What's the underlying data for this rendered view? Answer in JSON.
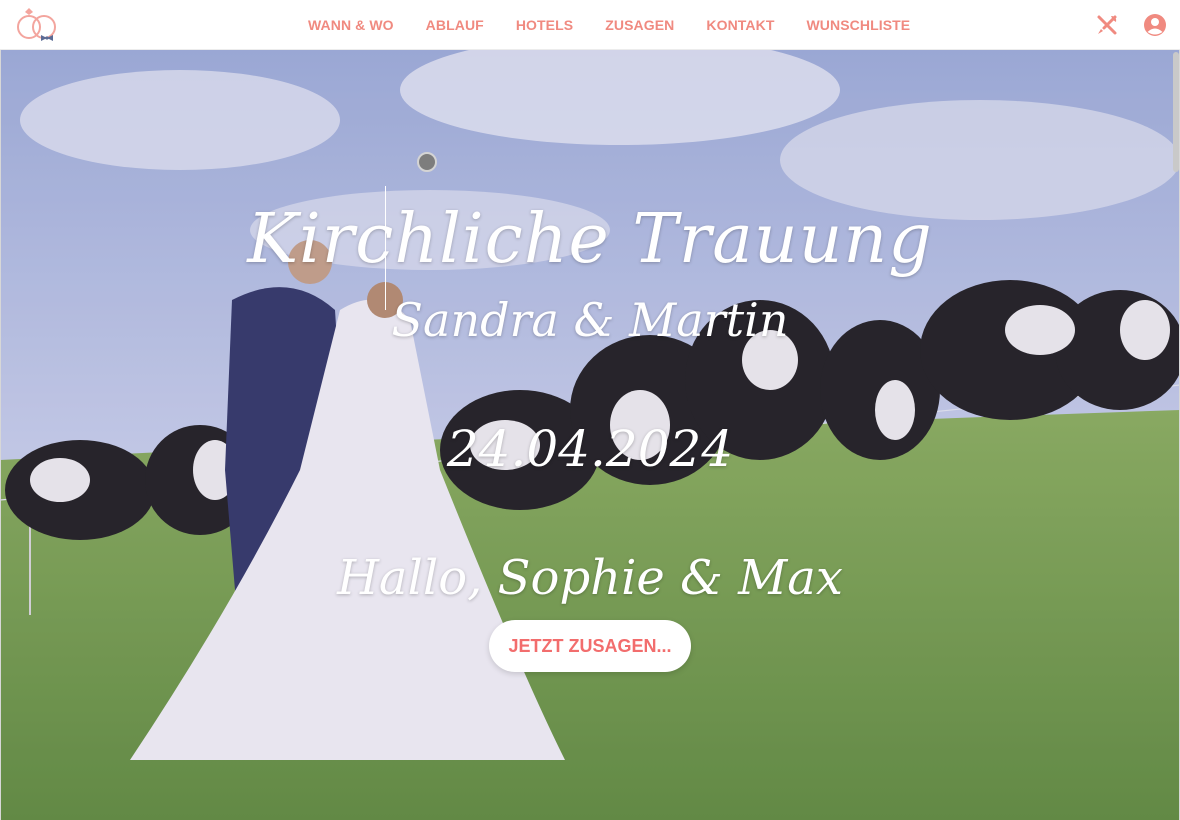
{
  "nav": {
    "links": [
      "WANN & WO",
      "ABLAUF",
      "HOTELS",
      "ZUSAGEN",
      "KONTAKT",
      "WUNSCHLISTE"
    ],
    "icons": [
      "rings-logo-icon",
      "dining-icon",
      "account-icon"
    ]
  },
  "hero": {
    "title": "Kirchliche Trauung",
    "couple": "Sandra & Martin",
    "date": "24.04.2024",
    "greeting": "Hallo, Sophie & Max",
    "cta_label": "JETZT ZUSAGEN..."
  },
  "colors": {
    "accent": "#f08a80",
    "cta_text": "#f26d6d",
    "logo_bow": "#5b6b95"
  }
}
